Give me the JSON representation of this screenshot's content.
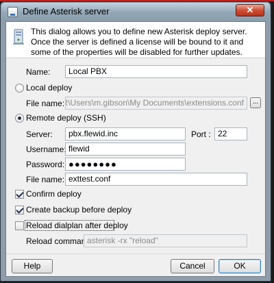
{
  "window": {
    "title": "Define Asterisk server",
    "close_glyph": "✕"
  },
  "header": {
    "icon": "server-icon",
    "description": "This dialog allows you to define new Asterisk deploy server. Once the server is defined a license will be bound to it and some of the properties will be disabled for further updates."
  },
  "form": {
    "name_label": "Name:",
    "name_value": "Local PBX",
    "local_deploy": {
      "label": "Local deploy",
      "selected": false,
      "file_label": "File name:",
      "file_value": "-SERVER\\Users\\m.gibson\\My Documents\\extensions.conf",
      "browse_label": "..."
    },
    "remote_deploy": {
      "label": "Remote deploy (SSH)",
      "selected": true,
      "server_label": "Server:",
      "server_value": "pbx.flewid.inc",
      "port_label": "Port :",
      "port_value": "22",
      "username_label": "Username:",
      "username_value": "flewid",
      "password_label": "Password:",
      "password_value": "●●●●●●●●",
      "file_label": "File name:",
      "file_value": "exttest.conf"
    },
    "options": {
      "confirm_deploy": {
        "label": "Confirm deploy",
        "checked": true
      },
      "create_backup": {
        "label": "Create backup before deploy",
        "checked": true
      },
      "reload_dialplan": {
        "label": "Reload dialplan after deploy",
        "checked": false
      },
      "reload_command_label": "Reload command:",
      "reload_command_value": "asterisk -rx \"reload\""
    }
  },
  "buttons": {
    "help": "Help",
    "cancel": "Cancel",
    "ok": "OK"
  }
}
